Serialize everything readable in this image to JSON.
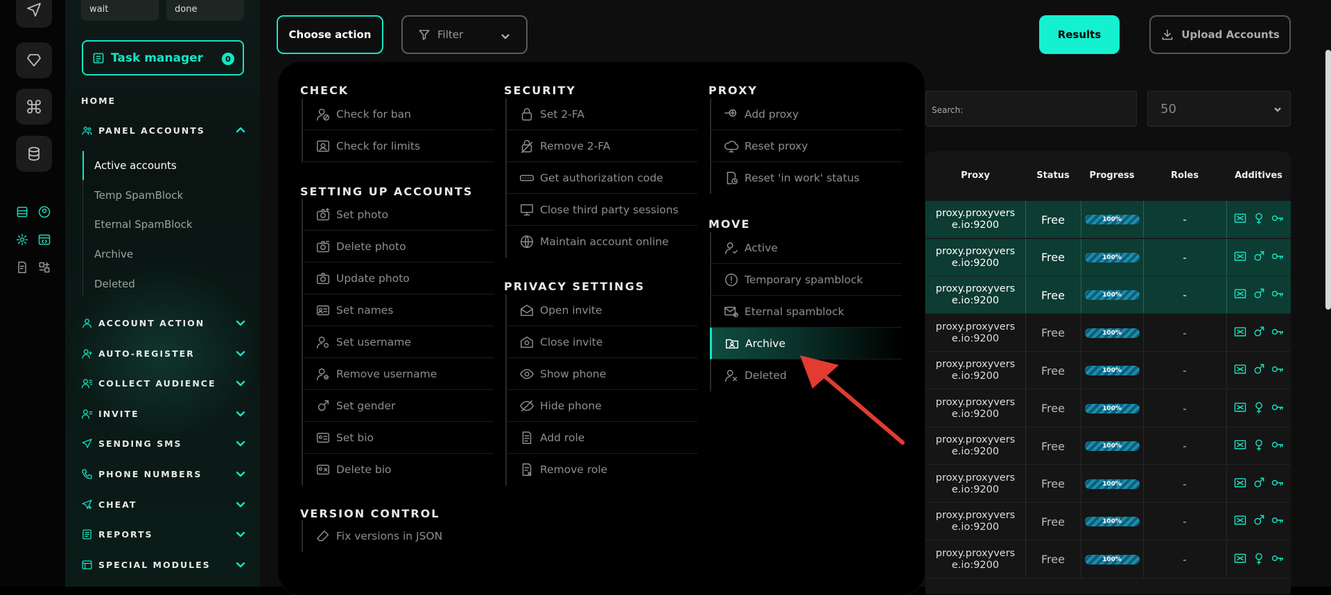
{
  "rail": {
    "buttons": [
      "send-icon",
      "diamond-icon",
      "command-icon",
      "database-icon"
    ]
  },
  "sidebar": {
    "pills": [
      "wait",
      "done"
    ],
    "task_manager": {
      "label": "Task manager",
      "count": "0"
    },
    "home": "HOME",
    "panel_accounts": "PANEL ACCOUNTS",
    "sub_items": [
      "Active accounts",
      "Temp SpamBlock",
      "Eternal SpamBlock",
      "Archive",
      "Deleted"
    ],
    "sections": [
      "ACCOUNT ACTION",
      "AUTO-REGISTER",
      "COLLECT AUDIENCE",
      "INVITE",
      "SENDING SMS",
      "PHONE NUMBERS",
      "CHEAT",
      "REPORTS",
      "SPECIAL MODULES"
    ]
  },
  "toolbar": {
    "choose_action": "Choose action",
    "filter": "Filter",
    "results": "Results",
    "upload": "Upload Accounts"
  },
  "search": {
    "placeholder": "Search:"
  },
  "per_page": {
    "value": "50"
  },
  "table": {
    "headers": [
      "Proxy",
      "Status",
      "Progress",
      "Roles",
      "Additives"
    ],
    "rows": [
      {
        "proxy": "proxy.proxyvers e.io:9200",
        "status": "Free",
        "progress": "100%",
        "roles": "-",
        "gender": "female",
        "highlight": true
      },
      {
        "proxy": "proxy.proxyvers e.io:9200",
        "status": "Free",
        "progress": "100%",
        "roles": "-",
        "gender": "male",
        "highlight": true
      },
      {
        "proxy": "proxy.proxyvers e.io:9200",
        "status": "Free",
        "progress": "100%",
        "roles": "-",
        "gender": "male",
        "highlight": true
      },
      {
        "proxy": "proxy.proxyvers e.io:9200",
        "status": "Free",
        "progress": "100%",
        "roles": "-",
        "gender": "male",
        "highlight": false
      },
      {
        "proxy": "proxy.proxyvers e.io:9200",
        "status": "Free",
        "progress": "100%",
        "roles": "-",
        "gender": "male",
        "highlight": false
      },
      {
        "proxy": "proxy.proxyvers e.io:9200",
        "status": "Free",
        "progress": "100%",
        "roles": "-",
        "gender": "female",
        "highlight": false
      },
      {
        "proxy": "proxy.proxyvers e.io:9200",
        "status": "Free",
        "progress": "100%",
        "roles": "-",
        "gender": "female",
        "highlight": false
      },
      {
        "proxy": "proxy.proxyvers e.io:9200",
        "status": "Free",
        "progress": "100%",
        "roles": "-",
        "gender": "male",
        "highlight": false
      },
      {
        "proxy": "proxy.proxyvers e.io:9200",
        "status": "Free",
        "progress": "100%",
        "roles": "-",
        "gender": "male",
        "highlight": false
      },
      {
        "proxy": "proxy.proxyvers e.io:9200",
        "status": "Free",
        "progress": "100%",
        "roles": "-",
        "gender": "female",
        "highlight": false
      }
    ]
  },
  "dropdown": {
    "check": {
      "title": "CHECK",
      "items": [
        "Check for ban",
        "Check for limits"
      ]
    },
    "setting_up": {
      "title": "SETTING UP ACCOUNTS",
      "items": [
        "Set photo",
        "Delete photo",
        "Update photo",
        "Set names",
        "Set username",
        "Remove username",
        "Set gender",
        "Set bio",
        "Delete bio"
      ]
    },
    "version": {
      "title": "VERSION CONTROL",
      "items": [
        "Fix versions in JSON"
      ]
    },
    "security": {
      "title": "SECURITY",
      "items": [
        "Set 2-FA",
        "Remove 2-FA",
        "Get authorization code",
        "Close third party sessions",
        "Maintain account online"
      ]
    },
    "privacy": {
      "title": "PRIVACY SETTINGS",
      "items": [
        "Open invite",
        "Close invite",
        "Show phone",
        "Hide phone",
        "Add role",
        "Remove role"
      ]
    },
    "proxy": {
      "title": "PROXY",
      "items": [
        "Add proxy",
        "Reset proxy",
        "Reset 'in work' status"
      ]
    },
    "move": {
      "title": "MOVE",
      "items": [
        "Active",
        "Temporary spamblock",
        "Eternal spamblock",
        "Archive",
        "Deleted"
      ],
      "active": "Archive"
    }
  },
  "colors": {
    "accent": "#14e6c6",
    "highlight_row": "#0d3c32",
    "arrow": "#e03c31"
  }
}
